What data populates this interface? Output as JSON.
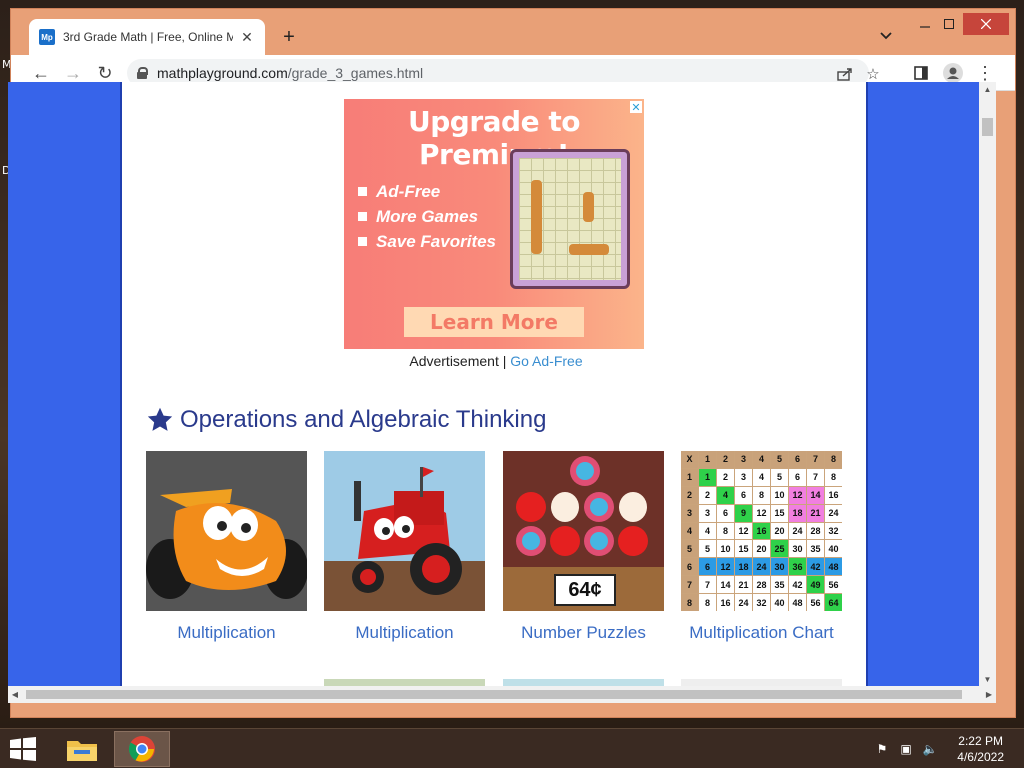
{
  "desktop": {
    "fragments": [
      "M",
      "D"
    ]
  },
  "browser": {
    "tab_title": "3rd Grade Math | Free, Online Ma",
    "favicon_text": "Mp",
    "url_host": "mathplayground.com",
    "url_path": "/grade_3_games.html"
  },
  "ad": {
    "title": "Upgrade to Premium!",
    "features": [
      "Ad-Free",
      "More Games",
      "Save Favorites"
    ],
    "cta": "Learn More",
    "caption": "Advertisement |",
    "caption_link": "Go Ad-Free"
  },
  "section": {
    "title": "Operations and Algebraic Thinking",
    "cards": [
      {
        "label": "Multiplication",
        "thumb": "race-car"
      },
      {
        "label": "Multiplication",
        "thumb": "tractor"
      },
      {
        "label": "Number Puzzles",
        "thumb": "candy-price",
        "price": "64¢"
      },
      {
        "label": "Multiplication Chart",
        "thumb": "times-table"
      }
    ]
  },
  "taskbar": {
    "time": "2:22 PM",
    "date": "4/6/2022"
  },
  "colors": {
    "page_bg": "#3764ea",
    "heading": "#2a3a8c",
    "link": "#3a6cc4",
    "ad_link": "#3a8ed0"
  }
}
